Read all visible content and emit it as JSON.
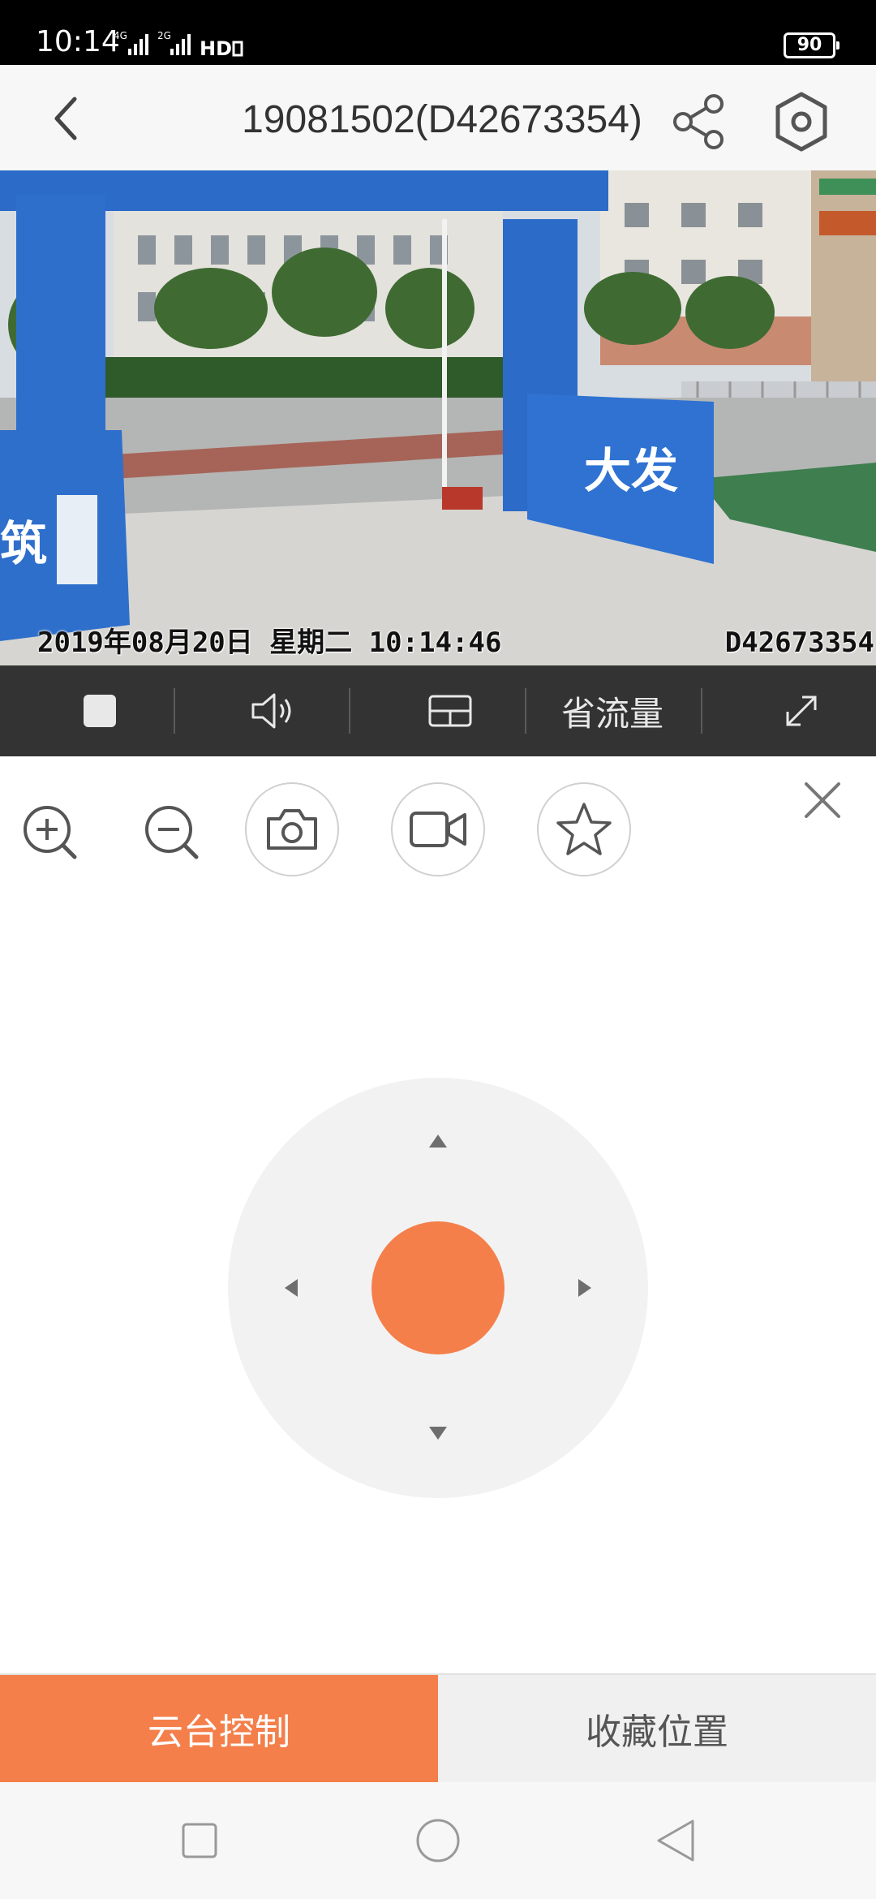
{
  "status_bar": {
    "time": "10:14",
    "network": "4G 2G HD",
    "battery": "90"
  },
  "header": {
    "title": "19081502(D42673354)"
  },
  "video": {
    "osd_datetime": "2019年08月20日 星期二 10:14:46",
    "osd_device_id": "D42673354",
    "sign_text": "大发",
    "sign_left_text": "筑"
  },
  "video_toolbar": {
    "save_traffic_label": "省流量"
  },
  "bottom_tabs": [
    {
      "label": "云台控制",
      "active": true
    },
    {
      "label": "收藏位置",
      "active": false
    }
  ],
  "colors": {
    "accent": "#f47f4b",
    "toolbar_bg": "#333333",
    "pad_bg": "#f2f2f2"
  },
  "icons": {
    "back": "chevron-left-icon",
    "share": "share-icon",
    "settings": "gear-icon",
    "stop": "stop-icon",
    "volume": "speaker-icon",
    "layout": "split-screen-icon",
    "fullscreen": "expand-icon",
    "zoom_in": "zoom-in-icon",
    "zoom_out": "zoom-out-icon",
    "snapshot": "camera-icon",
    "record": "video-camera-icon",
    "favorite": "star-icon",
    "close": "close-icon"
  }
}
